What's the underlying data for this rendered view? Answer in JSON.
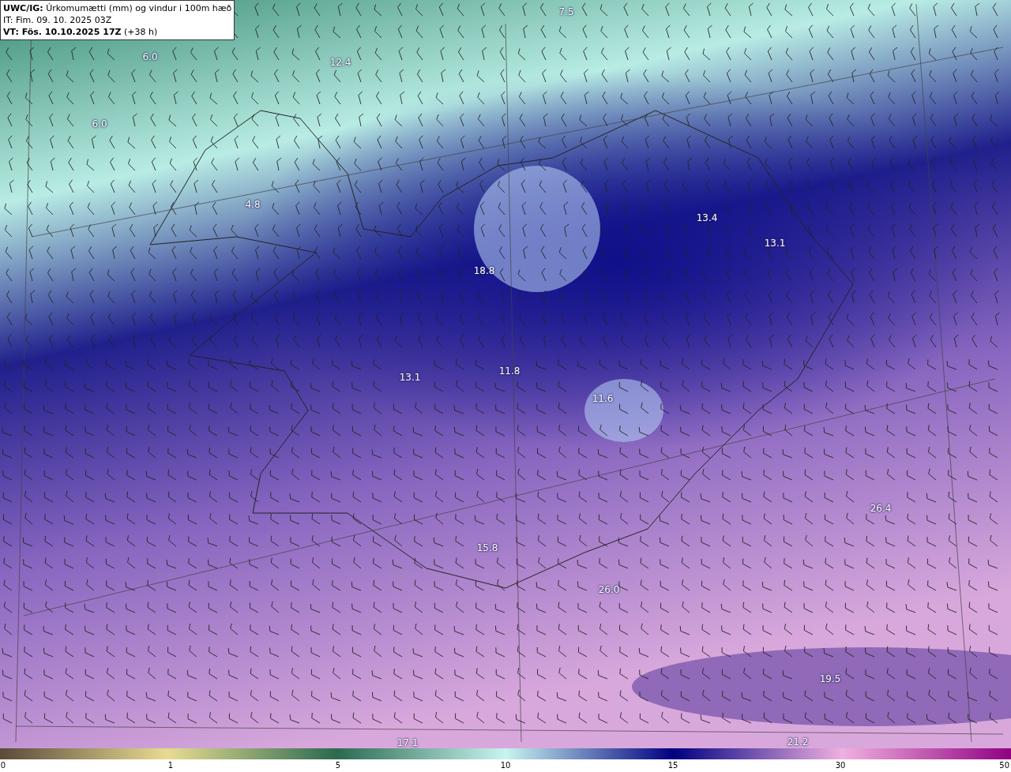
{
  "header": {
    "title": "**UWC/IG:** Úrkomumætti (mm) og vindur i 100m hæð",
    "issued": "IT: Fim. 09. 10. 2025 03Z",
    "valid": "**VT: Fös. 10.10.2025 17Z** (+38 h)"
  },
  "map_labels": [
    "7.5",
    "6.0",
    "12.4",
    "6.0",
    "4.8",
    "13.4",
    "13.1",
    "18.8",
    "13.1",
    "11.8",
    "11.6",
    "26.4",
    "15.8",
    "26.0",
    "19.5",
    "17.1",
    "21.2"
  ],
  "colorbar": {
    "ticks": [
      "0",
      "1",
      "5",
      "10",
      "15",
      "30",
      "50"
    ]
  }
}
